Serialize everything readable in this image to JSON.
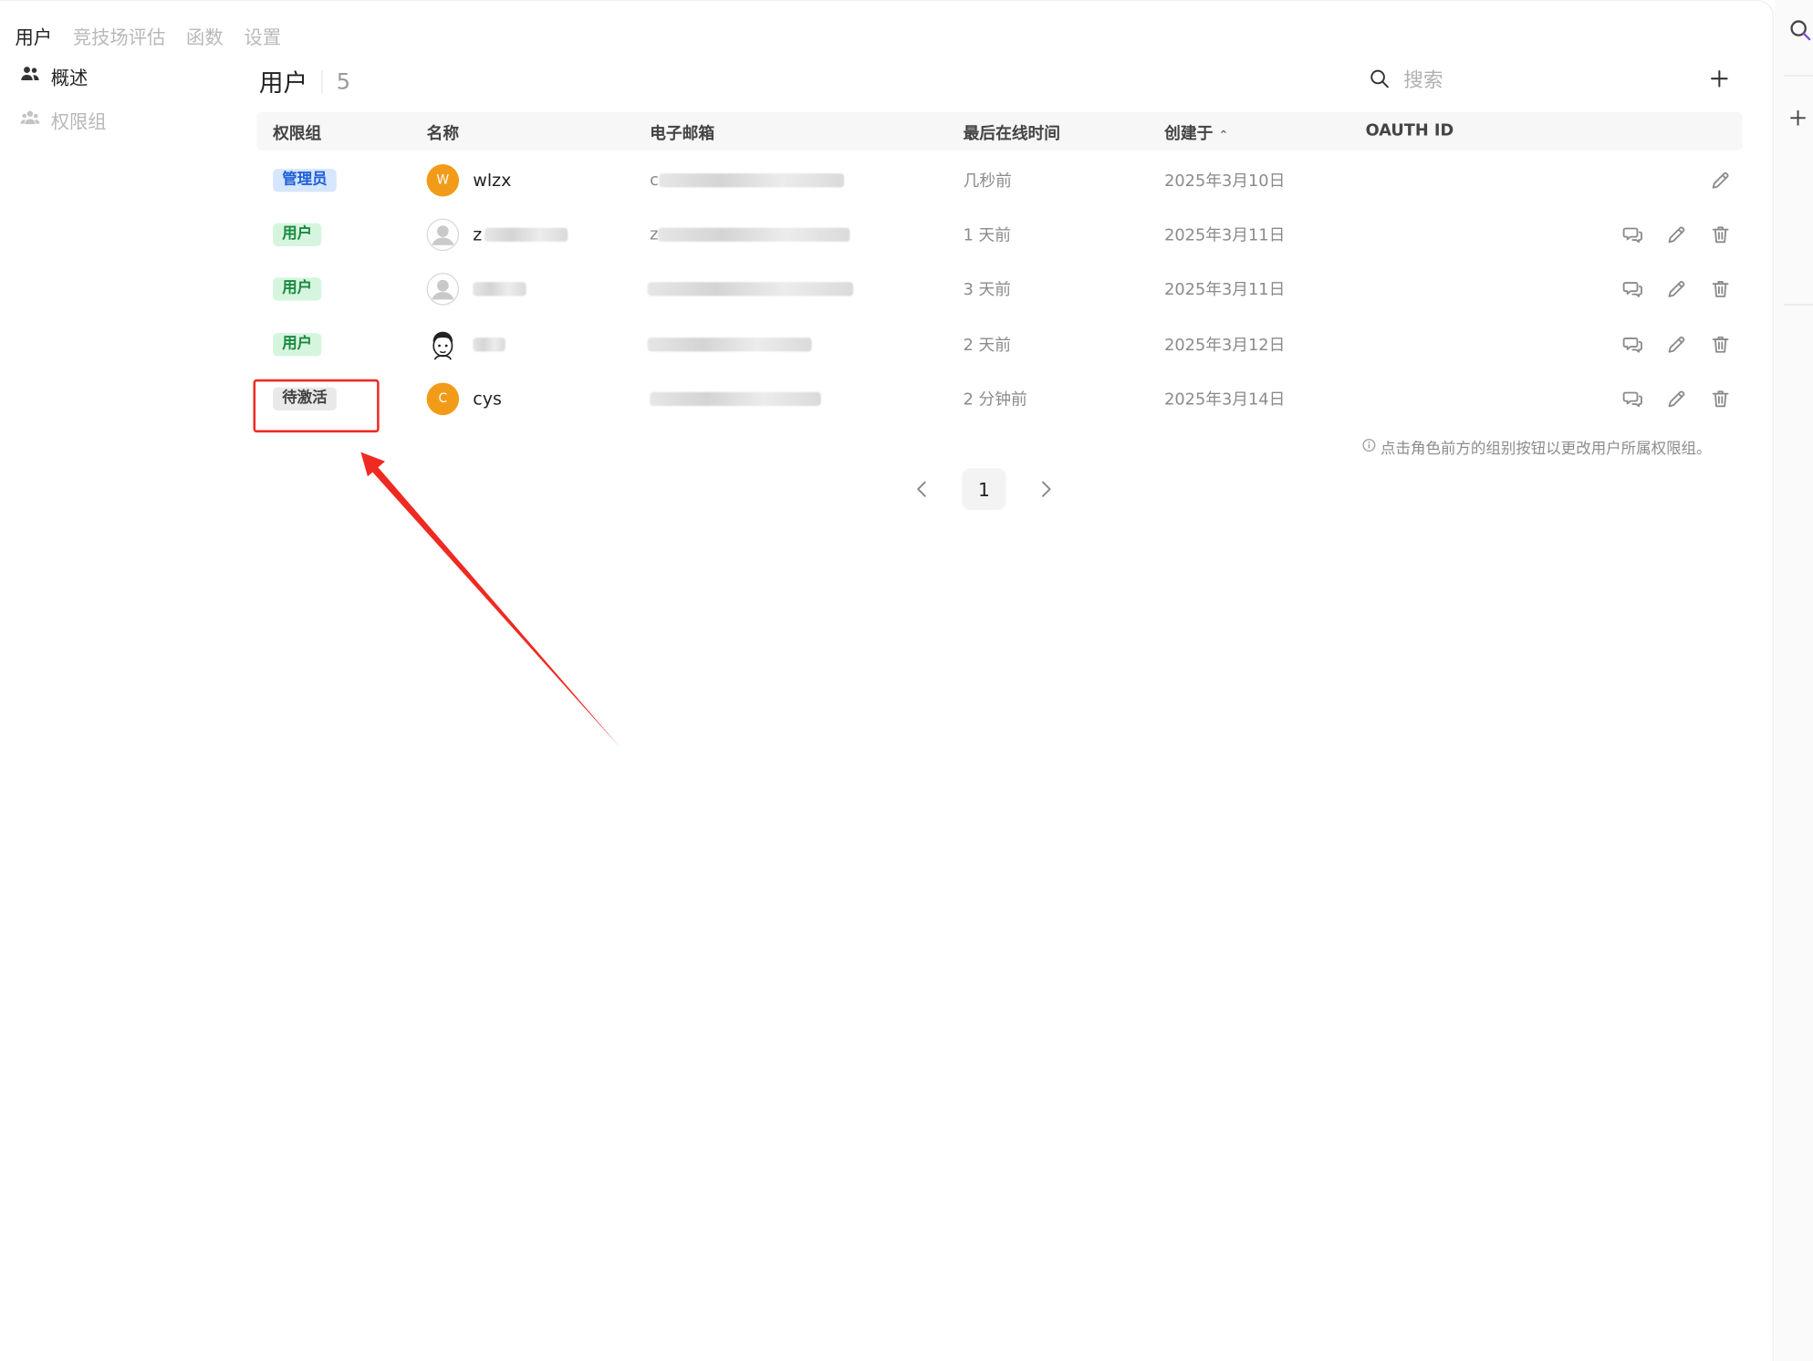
{
  "top_tabs": [
    "用户",
    "竞技场评估",
    "函数",
    "设置"
  ],
  "side_nav": [
    {
      "label": "概述",
      "icon": "users-icon"
    },
    {
      "label": "权限组",
      "icon": "user-group-icon"
    }
  ],
  "header": {
    "title": "用户",
    "count": "5"
  },
  "search": {
    "placeholder": "搜索"
  },
  "columns": [
    "权限组",
    "名称",
    "电子邮箱",
    "最后在线时间",
    "创建于",
    "OAUTH ID"
  ],
  "sort_column": "创建于",
  "rows": [
    {
      "role": "管理员",
      "role_type": "admin",
      "avatar": "orange",
      "avatar_letter": "W",
      "name": "wlzx",
      "email_visible": "c",
      "last_online": "几秒前",
      "created": "2025年3月10日",
      "actions": [
        "edit"
      ]
    },
    {
      "role": "用户",
      "role_type": "user",
      "avatar": "grey",
      "avatar_letter": "",
      "name": "z",
      "email_visible": "z",
      "last_online": "1 天前",
      "created": "2025年3月11日",
      "actions": [
        "chat",
        "edit",
        "delete"
      ]
    },
    {
      "role": "用户",
      "role_type": "user",
      "avatar": "grey",
      "avatar_letter": "",
      "name": "",
      "email_visible": "",
      "last_online": "3 天前",
      "created": "2025年3月11日",
      "actions": [
        "chat",
        "edit",
        "delete"
      ]
    },
    {
      "role": "用户",
      "role_type": "user",
      "avatar": "cartoon",
      "avatar_letter": "",
      "name": "",
      "email_visible": "",
      "last_online": "2 天前",
      "created": "2025年3月12日",
      "actions": [
        "chat",
        "edit",
        "delete"
      ]
    },
    {
      "role": "待激活",
      "role_type": "pending",
      "avatar": "orange",
      "avatar_letter": "C",
      "name": "cys",
      "email_visible": "",
      "last_online": "2 分钟前",
      "created": "2025年3月14日",
      "actions": [
        "chat",
        "edit",
        "delete"
      ]
    }
  ],
  "hint": "点击角色前方的组别按钮以更改用户所属权限组。",
  "pagination": {
    "current": "1"
  },
  "colors": {
    "annotation": "#ee2a22",
    "admin_badge": "#d7e6ff",
    "user_badge": "#d6f5df",
    "pending_badge": "#e9e9e9",
    "avatar_orange": "#f29b18"
  }
}
